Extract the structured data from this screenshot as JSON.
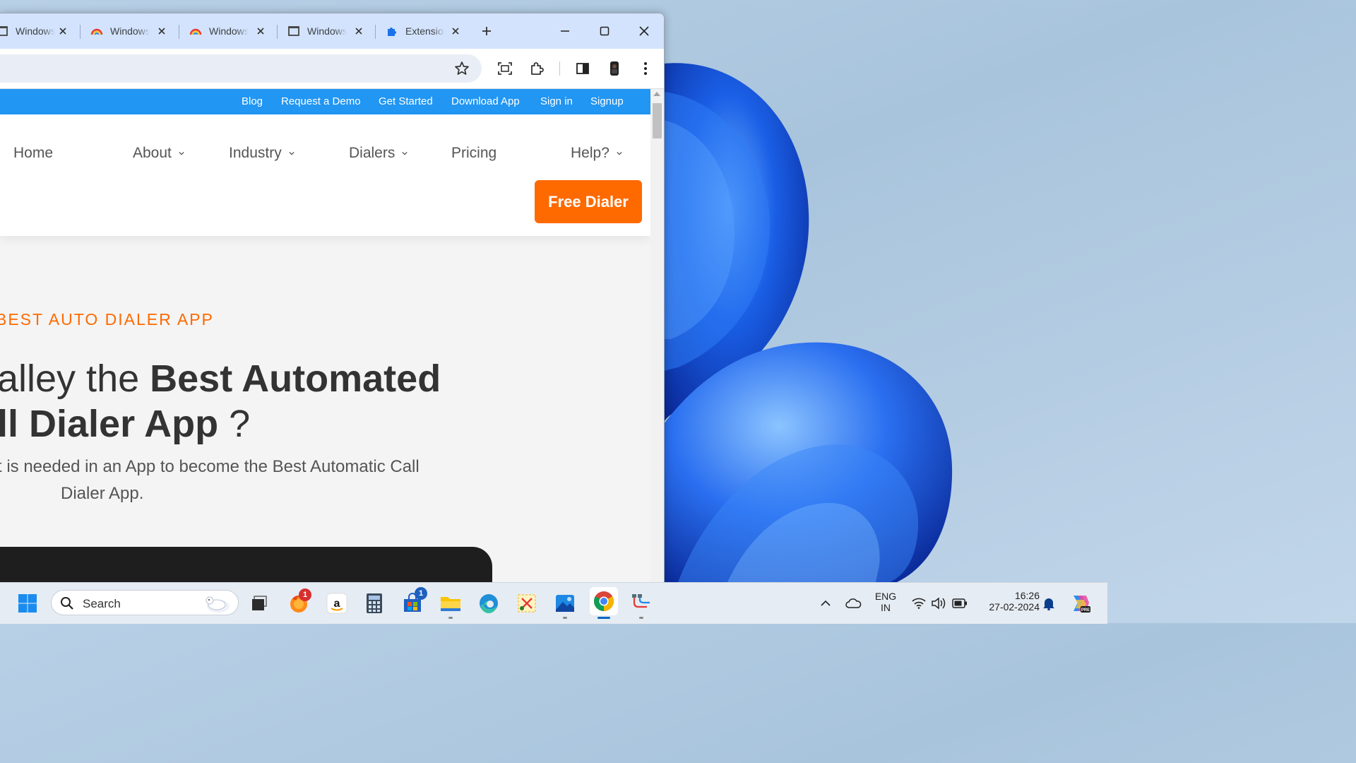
{
  "tabs": [
    {
      "label": "Windows",
      "icon": "window-frame-icon"
    },
    {
      "label": "Windows",
      "icon": "rainbow-icon"
    },
    {
      "label": "Windows",
      "icon": "rainbow-icon"
    },
    {
      "label": "Windows",
      "icon": "window-frame-icon"
    },
    {
      "label": "Extensions",
      "icon": "puzzle-icon"
    }
  ],
  "site": {
    "top_links": [
      "Blog",
      "Request a Demo",
      "Get Started",
      "Download App",
      "Sign in",
      "Signup"
    ],
    "nav": [
      "Home",
      "About",
      "Industry",
      "Dialers",
      "Pricing",
      "Help?"
    ],
    "cta": "Free Dialer",
    "eyebrow": "BEST AUTO DIALER APP",
    "headline_line1_plain": "alley the ",
    "headline_line1_bold": "Best Automated",
    "headline_line2_bold": "ll Dialer App",
    "headline_line2_plain": " ?",
    "subtitle_line1": "t is needed in an App to become the Best Automatic Call",
    "subtitle_line2": "Dialer App."
  },
  "taskbar": {
    "search_placeholder": "Search",
    "firefox_badge": "1",
    "store_badge": "1",
    "lang_top": "ENG",
    "lang_bottom": "IN",
    "time": "16:26",
    "date": "27-02-2024"
  },
  "colors": {
    "site_blue": "#2196f3",
    "cta_orange": "#fe6a00",
    "tab_strip": "#d3e3fd"
  }
}
